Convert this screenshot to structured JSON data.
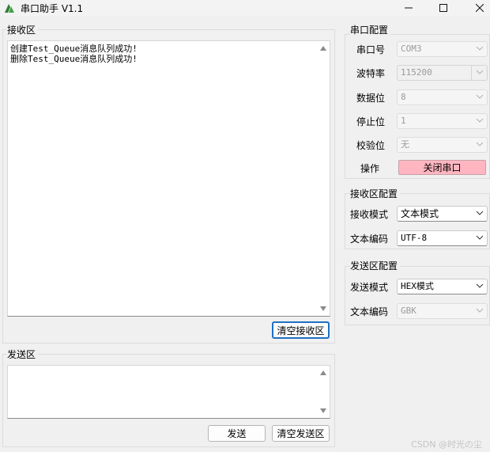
{
  "window": {
    "title": "串口助手 V1.1",
    "icons": [
      "app-leaf-icon",
      "minimize-icon",
      "maximize-icon",
      "close-icon"
    ]
  },
  "receive_area": {
    "title": "接收区",
    "lines": [
      "创建Test_Queue消息队列成功!",
      "删除Test_Queue消息队列成功!"
    ],
    "clear_button": "清空接收区"
  },
  "send_area": {
    "title": "发送区",
    "content": "",
    "send_button": "发送",
    "clear_button": "清空发送区"
  },
  "serial_config": {
    "title": "串口配置",
    "port": {
      "label": "串口号",
      "value": "COM3"
    },
    "baud": {
      "label": "波特率",
      "value": "115200"
    },
    "data_bits": {
      "label": "数据位",
      "value": "8"
    },
    "stop_bits": {
      "label": "停止位",
      "value": "1"
    },
    "parity": {
      "label": "校验位",
      "value": "无"
    },
    "operation": {
      "label": "操作",
      "button": "关闭串口",
      "button_color": "#ffb6c1"
    }
  },
  "receive_config": {
    "title": "接收区配置",
    "mode": {
      "label": "接收模式",
      "value": "文本模式"
    },
    "encoding": {
      "label": "文本编码",
      "value": "UTF-8"
    }
  },
  "send_config": {
    "title": "发送区配置",
    "mode": {
      "label": "发送模式",
      "value": "HEX模式"
    },
    "encoding": {
      "label": "文本编码",
      "value": "GBK"
    }
  },
  "watermark": "CSDN @时光の尘"
}
